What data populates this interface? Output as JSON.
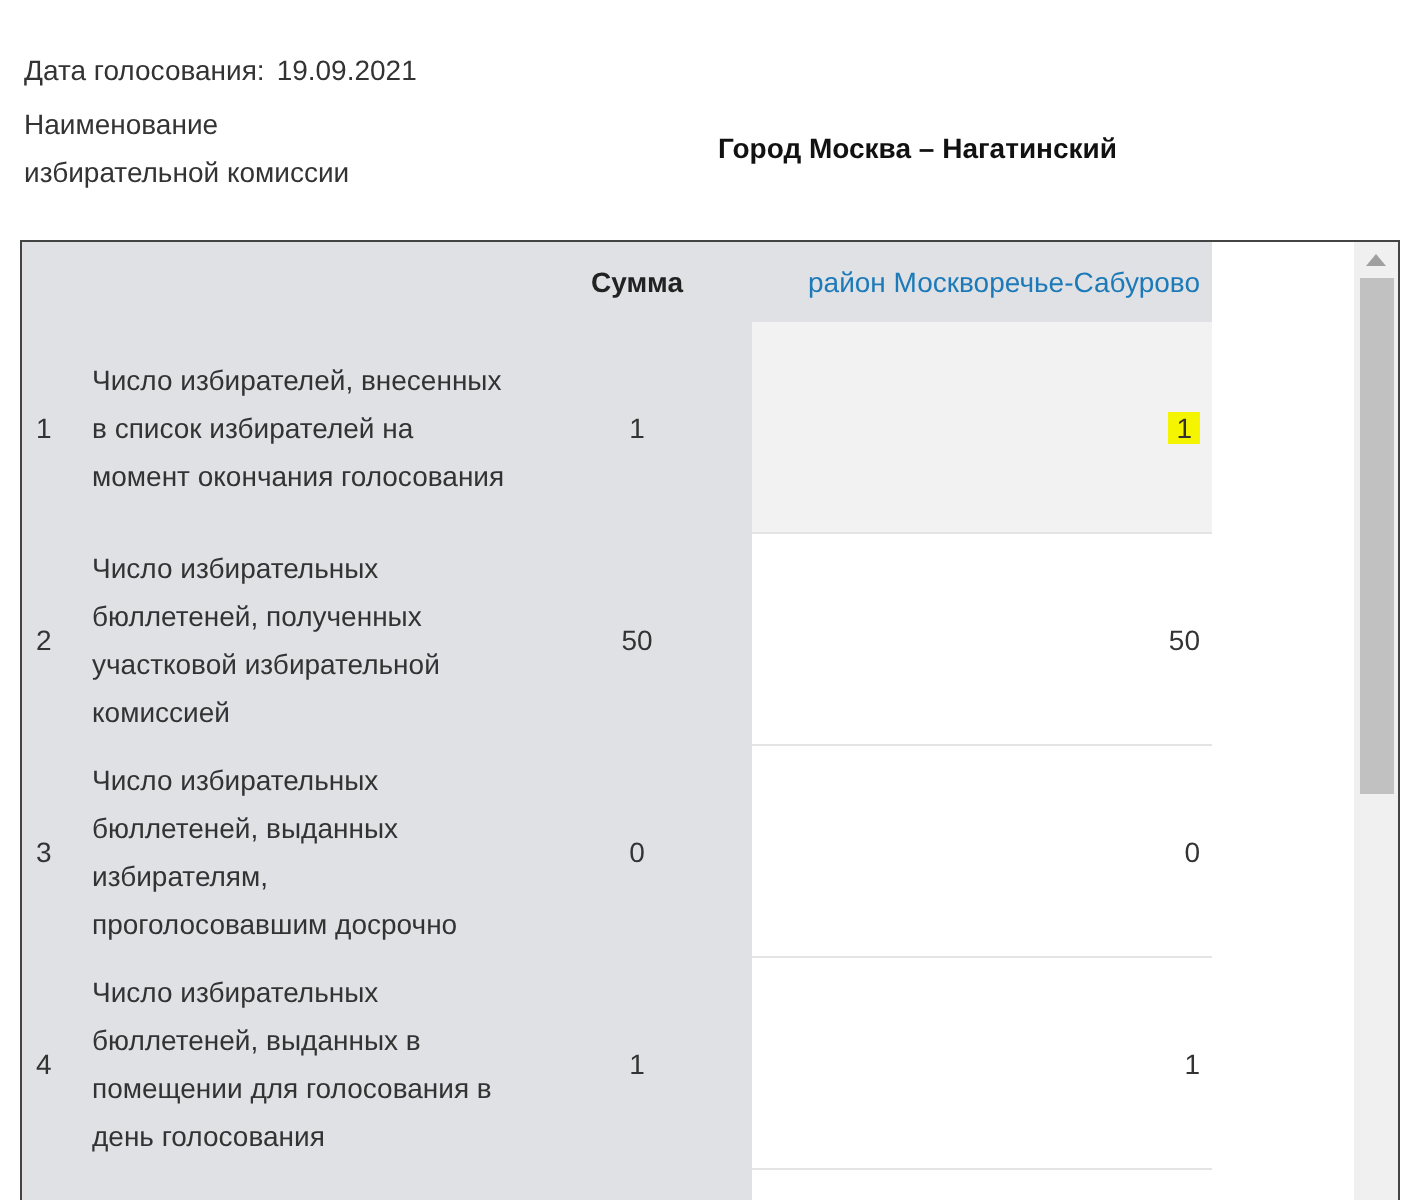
{
  "header": {
    "date_label": "Дата голосования:",
    "date_value": "19.09.2021",
    "commission_label": "Наименование избирательной комиссии",
    "commission_value": "Город Москва – Нагатинский"
  },
  "table": {
    "columns": [
      {
        "label": "Сумма"
      },
      {
        "label": "район Москворечье-Сабурово"
      }
    ],
    "rows": [
      {
        "number": "1",
        "label": "Число избирателей, внесенных в список избирателей на момент окончания голосования",
        "sum": "1",
        "value": "1",
        "highlighted": true,
        "selected": true
      },
      {
        "number": "2",
        "label": "Число избирательных бюллетеней, полученных участковой избирательной комиссией",
        "sum": "50",
        "value": "50",
        "highlighted": false,
        "selected": false
      },
      {
        "number": "3",
        "label": "Число избирательных бюллетеней, выданных избирателям, проголосовавшим досрочно",
        "sum": "0",
        "value": "0",
        "highlighted": false,
        "selected": false
      },
      {
        "number": "4",
        "label": "Число избирательных бюллетеней, выданных в помещении для голосования в день голосования",
        "sum": "1",
        "value": "1",
        "highlighted": false,
        "selected": false
      }
    ]
  }
}
